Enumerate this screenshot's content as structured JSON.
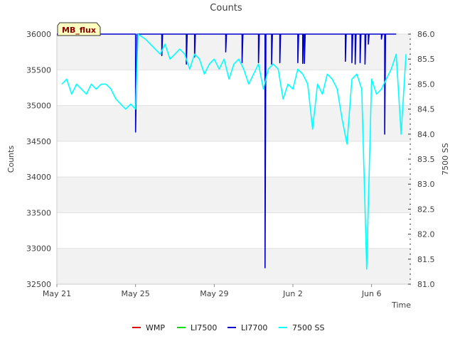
{
  "chart_data": {
    "type": "line",
    "title": "Counts",
    "xlabel": "Time",
    "ylabel_left": "Counts",
    "ylabel_right": "7500 SS",
    "badge": "MB_flux",
    "x_range": [
      "2023-05-21",
      "2023-06-08"
    ],
    "x_ticks": [
      {
        "label": "May 21",
        "date": "2023-05-21"
      },
      {
        "label": "May 25",
        "date": "2023-05-25"
      },
      {
        "label": "May 29",
        "date": "2023-05-29"
      },
      {
        "label": "Jun 2",
        "date": "2023-06-02"
      },
      {
        "label": "Jun 6",
        "date": "2023-06-06"
      }
    ],
    "ylim_left": [
      32500,
      36000
    ],
    "y_ticks_left": [
      "32500",
      "33000",
      "33500",
      "34000",
      "34500",
      "35000",
      "35500",
      "36000"
    ],
    "ylim_right": [
      81.0,
      86.0
    ],
    "y_ticks_right": [
      "81.0",
      "81.5",
      "82.0",
      "82.5",
      "83.0",
      "83.5",
      "84.0",
      "84.5",
      "85.0",
      "85.5",
      "86.0"
    ],
    "grid": "horizontal bands",
    "legend_placement": "bottom",
    "series": [
      {
        "name": "WMP",
        "color": "#dd0000",
        "axis": "left",
        "points": []
      },
      {
        "name": "LI7500",
        "color": "#00dd00",
        "axis": "left",
        "points": []
      },
      {
        "name": "LI7700",
        "color": "#0000cc",
        "axis": "left",
        "points": [
          [
            "2023-05-21T00:00",
            36000
          ],
          [
            "2023-05-25T00:00",
            36000
          ],
          [
            "2023-05-25T00:00",
            34630
          ],
          [
            "2023-05-25T02:00",
            36000
          ],
          [
            "2023-05-26T08:00",
            36000
          ],
          [
            "2023-05-26T08:00",
            35700
          ],
          [
            "2023-05-26T09:00",
            36000
          ],
          [
            "2023-05-27T14:00",
            36000
          ],
          [
            "2023-05-27T14:00",
            35580
          ],
          [
            "2023-05-27T15:00",
            36000
          ],
          [
            "2023-05-28T00:00",
            36000
          ],
          [
            "2023-05-28T00:00",
            35680
          ],
          [
            "2023-05-28T01:00",
            36000
          ],
          [
            "2023-05-29T14:00",
            36000
          ],
          [
            "2023-05-29T14:00",
            35750
          ],
          [
            "2023-05-29T15:00",
            36000
          ],
          [
            "2023-05-30T10:00",
            36000
          ],
          [
            "2023-05-30T10:00",
            35600
          ],
          [
            "2023-05-30T11:00",
            36000
          ],
          [
            "2023-05-31T06:00",
            36000
          ],
          [
            "2023-05-31T06:00",
            35600
          ],
          [
            "2023-05-31T07:00",
            36000
          ],
          [
            "2023-05-31T14:00",
            36000
          ],
          [
            "2023-05-31T14:00",
            32730
          ],
          [
            "2023-05-31T15:00",
            36000
          ],
          [
            "2023-05-31T22:00",
            36000
          ],
          [
            "2023-05-31T22:00",
            35580
          ],
          [
            "2023-05-31T23:00",
            36000
          ],
          [
            "2023-06-01T08:00",
            36000
          ],
          [
            "2023-06-01T08:00",
            35600
          ],
          [
            "2023-06-01T09:00",
            36000
          ],
          [
            "2023-06-02T06:00",
            36000
          ],
          [
            "2023-06-02T06:00",
            35600
          ],
          [
            "2023-06-02T07:00",
            36000
          ],
          [
            "2023-06-02T12:00",
            36000
          ],
          [
            "2023-06-02T12:00",
            35590
          ],
          [
            "2023-06-02T13:00",
            36000
          ],
          [
            "2023-06-02T14:00",
            36000
          ],
          [
            "2023-06-02T14:00",
            35590
          ],
          [
            "2023-06-02T15:00",
            36000
          ],
          [
            "2023-06-04T16:00",
            36000
          ],
          [
            "2023-06-04T16:00",
            35620
          ],
          [
            "2023-06-04T17:00",
            36000
          ],
          [
            "2023-06-05T00:00",
            36000
          ],
          [
            "2023-06-05T00:00",
            35600
          ],
          [
            "2023-06-05T01:00",
            36000
          ],
          [
            "2023-06-05T04:00",
            36000
          ],
          [
            "2023-06-05T04:00",
            35580
          ],
          [
            "2023-06-05T05:00",
            36000
          ],
          [
            "2023-06-05T10:00",
            36000
          ],
          [
            "2023-06-05T10:00",
            35600
          ],
          [
            "2023-06-05T11:00",
            36000
          ],
          [
            "2023-06-05T16:00",
            36000
          ],
          [
            "2023-06-05T16:00",
            35580
          ],
          [
            "2023-06-05T17:00",
            36000
          ],
          [
            "2023-06-05T20:00",
            36000
          ],
          [
            "2023-06-05T20:00",
            35860
          ],
          [
            "2023-06-05T21:00",
            36000
          ],
          [
            "2023-06-06T12:00",
            36000
          ],
          [
            "2023-06-06T12:00",
            35930
          ],
          [
            "2023-06-06T13:00",
            36000
          ],
          [
            "2023-06-06T16:00",
            36000
          ],
          [
            "2023-06-06T16:00",
            34600
          ],
          [
            "2023-06-06T17:00",
            36000
          ],
          [
            "2023-06-07T06:00",
            36000
          ]
        ]
      },
      {
        "name": "7500 SS",
        "color": "#00ffff",
        "axis": "right",
        "points": [
          [
            "2023-05-21T06:00",
            85.0
          ],
          [
            "2023-05-21T12:00",
            85.1
          ],
          [
            "2023-05-21T18:00",
            84.8
          ],
          [
            "2023-05-22T00:00",
            85.0
          ],
          [
            "2023-05-22T06:00",
            84.9
          ],
          [
            "2023-05-22T12:00",
            84.8
          ],
          [
            "2023-05-22T18:00",
            85.0
          ],
          [
            "2023-05-23T00:00",
            84.9
          ],
          [
            "2023-05-23T06:00",
            85.0
          ],
          [
            "2023-05-23T12:00",
            85.0
          ],
          [
            "2023-05-23T18:00",
            84.9
          ],
          [
            "2023-05-24T00:00",
            84.7
          ],
          [
            "2023-05-24T06:00",
            84.6
          ],
          [
            "2023-05-24T12:00",
            84.5
          ],
          [
            "2023-05-24T18:00",
            84.6
          ],
          [
            "2023-05-25T00:00",
            84.5
          ],
          [
            "2023-05-25T03:00",
            86.0
          ],
          [
            "2023-05-25T12:00",
            85.9
          ],
          [
            "2023-05-25T18:00",
            85.8
          ],
          [
            "2023-05-26T00:00",
            85.7
          ],
          [
            "2023-05-26T06:00",
            85.6
          ],
          [
            "2023-05-26T12:00",
            85.8
          ],
          [
            "2023-05-26T18:00",
            85.5
          ],
          [
            "2023-05-27T00:00",
            85.6
          ],
          [
            "2023-05-27T06:00",
            85.7
          ],
          [
            "2023-05-27T12:00",
            85.6
          ],
          [
            "2023-05-27T18:00",
            85.3
          ],
          [
            "2023-05-28T00:00",
            85.6
          ],
          [
            "2023-05-28T06:00",
            85.5
          ],
          [
            "2023-05-28T12:00",
            85.2
          ],
          [
            "2023-05-28T18:00",
            85.4
          ],
          [
            "2023-05-29T00:00",
            85.5
          ],
          [
            "2023-05-29T06:00",
            85.3
          ],
          [
            "2023-05-29T12:00",
            85.5
          ],
          [
            "2023-05-29T18:00",
            85.1
          ],
          [
            "2023-05-30T00:00",
            85.4
          ],
          [
            "2023-05-30T06:00",
            85.5
          ],
          [
            "2023-05-30T12:00",
            85.3
          ],
          [
            "2023-05-30T18:00",
            85.0
          ],
          [
            "2023-05-31T00:00",
            85.2
          ],
          [
            "2023-05-31T06:00",
            85.4
          ],
          [
            "2023-05-31T12:00",
            84.9
          ],
          [
            "2023-05-31T18:00",
            85.3
          ],
          [
            "2023-06-01T00:00",
            85.4
          ],
          [
            "2023-06-01T06:00",
            85.3
          ],
          [
            "2023-06-01T12:00",
            84.7
          ],
          [
            "2023-06-01T18:00",
            85.0
          ],
          [
            "2023-06-02T00:00",
            84.9
          ],
          [
            "2023-06-02T06:00",
            85.3
          ],
          [
            "2023-06-02T12:00",
            85.2
          ],
          [
            "2023-06-02T18:00",
            85.0
          ],
          [
            "2023-06-03T00:00",
            84.1
          ],
          [
            "2023-06-03T06:00",
            85.0
          ],
          [
            "2023-06-03T12:00",
            84.8
          ],
          [
            "2023-06-03T18:00",
            85.2
          ],
          [
            "2023-06-04T00:00",
            85.1
          ],
          [
            "2023-06-04T06:00",
            84.9
          ],
          [
            "2023-06-04T12:00",
            84.3
          ],
          [
            "2023-06-04T18:00",
            83.8
          ],
          [
            "2023-06-05T00:00",
            85.1
          ],
          [
            "2023-06-05T06:00",
            85.2
          ],
          [
            "2023-06-05T12:00",
            84.9
          ],
          [
            "2023-06-05T18:00",
            81.3
          ],
          [
            "2023-06-06T00:00",
            85.1
          ],
          [
            "2023-06-06T06:00",
            84.8
          ],
          [
            "2023-06-06T12:00",
            84.9
          ],
          [
            "2023-06-06T18:00",
            85.1
          ],
          [
            "2023-06-07T00:00",
            85.3
          ],
          [
            "2023-06-07T06:00",
            85.6
          ],
          [
            "2023-06-07T12:00",
            84.0
          ],
          [
            "2023-06-07T18:00",
            85.6
          ]
        ]
      }
    ]
  }
}
